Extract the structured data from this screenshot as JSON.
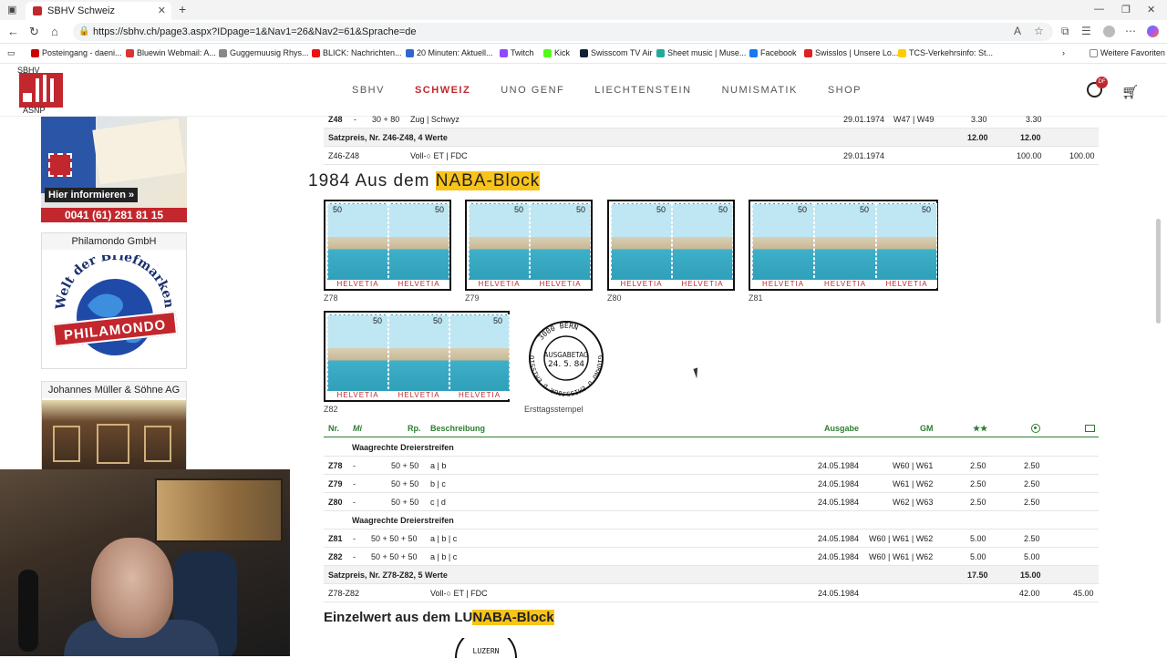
{
  "browser": {
    "tab_title": "SBHV Schweiz",
    "url": "https://sbhv.ch/page3.aspx?IDpage=1&Nav1=26&Nav2=61&Sprache=de",
    "bookmarks": [
      "Posteingang - daeni...",
      "Bluewin Webmail: A...",
      "Guggemuusig Rhys...",
      "BLICK: Nachrichten...",
      "20 Minuten: Aktuell...",
      "Twitch",
      "Kick",
      "Swisscom TV Air",
      "Sheet music | Muse...",
      "Facebook",
      "Swisslos | Unsere Lo...",
      "TCS-Verkehrsinfo: St..."
    ],
    "bookmarks_other": "Weitere Favoriten"
  },
  "site": {
    "logo_top": "SBHV",
    "logo_bottom": "ASNP",
    "nav": [
      "SBHV",
      "SCHWEIZ",
      "UNO GENF",
      "LIECHTENSTEIN",
      "NUMISMATIK",
      "SHOP"
    ],
    "nav_active": "SCHWEIZ",
    "user_badge": "DF"
  },
  "sidebar": {
    "ad1_cta": "Hier informieren »",
    "ad1_phone": "0041 (61) 281 81 15",
    "ad2_title": "Philamondo GmbH",
    "ad2_text_arc": "Welt der Briefmarken",
    "ad2_banner": "PHILAMONDO",
    "ad3_title": "Johannes Müller & Söhne AG"
  },
  "top_table": {
    "row1": {
      "nr": "Z48",
      "mi": "-",
      "rp": "30 + 80",
      "desc": "Zug | Schwyz",
      "date": "29.01.1974",
      "gm": "W47 | W49",
      "mint": "3.30",
      "used": "3.30"
    },
    "row2": {
      "label": "Satzpreis, Nr. Z46-Z48, 4 Werte",
      "mint": "12.00",
      "used": "12.00"
    },
    "row3": {
      "nr": "Z46-Z48",
      "desc": "Voll-○ ET | FDC",
      "date": "29.01.1974",
      "fdc1": "100.00",
      "fdc2": "100.00"
    }
  },
  "section1": {
    "title_pre": "1984 Aus dem ",
    "title_hl": "NABA-Block",
    "stamps": [
      {
        "code": "Z78",
        "values": [
          "50",
          "50"
        ]
      },
      {
        "code": "Z79",
        "values": [
          "50",
          "50"
        ]
      },
      {
        "code": "Z80",
        "values": [
          "50",
          "50"
        ]
      },
      {
        "code": "Z81",
        "values": [
          "50",
          "50",
          "50"
        ]
      },
      {
        "code": "Z82",
        "values": [
          "50",
          "50",
          "50"
        ]
      }
    ],
    "stamp_label": "HELVETIA",
    "postmark_top": "3000 BERN",
    "postmark_side_left": "JOUR D'EMISSION",
    "postmark_side_right": "GIORNO D'EMISSIONE",
    "postmark_center": "AUSGABETAG",
    "postmark_date": "24. 5. 84",
    "postmark_caption": "Ersttagsstempel"
  },
  "table": {
    "headers": {
      "nr": "Nr.",
      "mi": "Mi",
      "rp": "Rp.",
      "desc": "Beschreibung",
      "date": "Ausgabe",
      "gm": "GM",
      "mint": "★★",
      "used_icon": "circle-dot-icon",
      "fdc_icon": "envelope-icon"
    },
    "group1": "Waagrechte Dreierstreifen",
    "group2": "Waagrechte Dreierstreifen",
    "rows": [
      {
        "nr": "Z78",
        "mi": "-",
        "rp": "50 + 50",
        "desc": "a | b",
        "date": "24.05.1984",
        "gm": "W60 | W61",
        "mint": "2.50",
        "used": "2.50"
      },
      {
        "nr": "Z79",
        "mi": "-",
        "rp": "50 + 50",
        "desc": "b | c",
        "date": "24.05.1984",
        "gm": "W61 | W62",
        "mint": "2.50",
        "used": "2.50"
      },
      {
        "nr": "Z80",
        "mi": "-",
        "rp": "50 + 50",
        "desc": "c | d",
        "date": "24.05.1984",
        "gm": "W62 | W63",
        "mint": "2.50",
        "used": "2.50"
      },
      {
        "nr": "Z81",
        "mi": "-",
        "rp": "50 + 50 + 50",
        "desc": "a | b | c",
        "date": "24.05.1984",
        "gm": "W60 | W61 | W62",
        "mint": "5.00",
        "used": "2.50"
      },
      {
        "nr": "Z82",
        "mi": "-",
        "rp": "50 + 50 + 50",
        "desc": "a | b | c",
        "date": "24.05.1984",
        "gm": "W60 | W61 | W62",
        "mint": "5.00",
        "used": "5.00"
      }
    ],
    "set": {
      "label": "Satzpreis, Nr. Z78-Z82, 5 Werte",
      "mint": "17.50",
      "used": "15.00"
    },
    "fdc": {
      "nr": "Z78-Z82",
      "desc": "Voll-○ ET | FDC",
      "date": "24.05.1984",
      "fdc1": "42.00",
      "fdc2": "45.00"
    }
  },
  "section2": {
    "title_pre": "Einzelwert aus dem LU",
    "title_hl": "NABA-Block",
    "postmark_partial": "LUZERN"
  },
  "colors": {
    "brand": "#c1272d",
    "highlight": "#f8c31a",
    "header_green": "#2e7d32"
  }
}
